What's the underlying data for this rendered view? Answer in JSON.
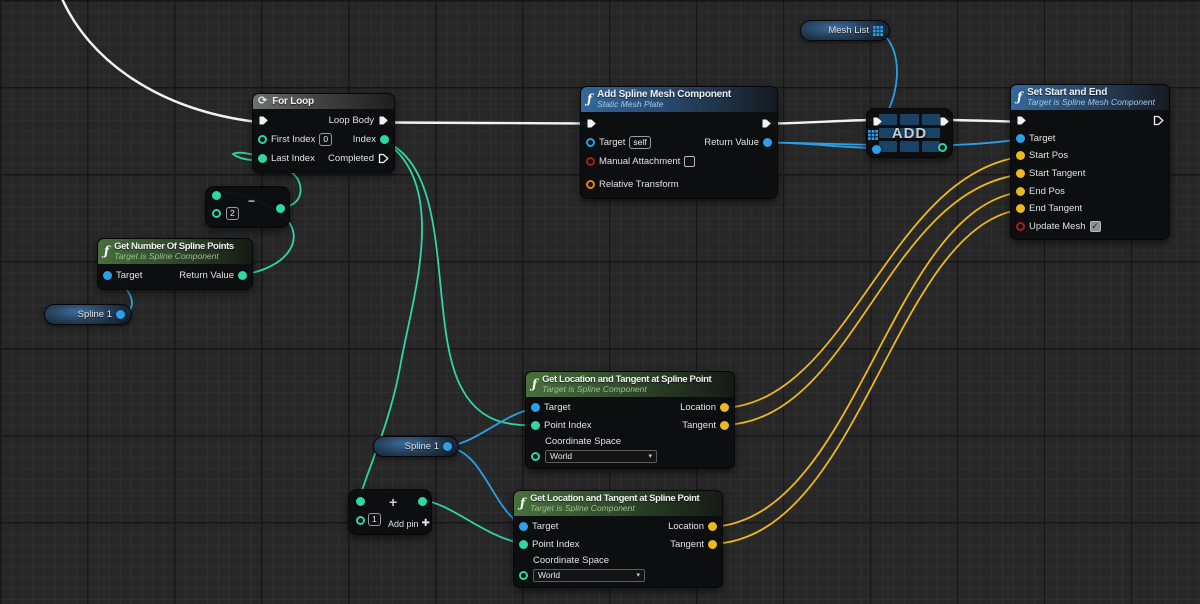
{
  "colors": {
    "exec_wire": "#F2F2F2",
    "int_pin": "#2FD6A6",
    "object_pin": "#2D9FE6",
    "vector_pin": "#EDB71E",
    "bool_pin": "#A61E1E",
    "transform_pin": "#E8820D"
  },
  "icons": {
    "function": "ƒ",
    "loop": "⟳",
    "dropdown_caret": "▾",
    "check": "✓",
    "add_pin_plus": "✚"
  },
  "nodes": {
    "for_loop": {
      "title": "For Loop",
      "loop_body_label": "Loop Body",
      "first_index_label": "First Index",
      "first_index_value": "0",
      "index_label": "Index",
      "last_index_label": "Last Index",
      "completed_label": "Completed"
    },
    "add_spline_mesh": {
      "title": "Add Spline Mesh Component",
      "subtitle": "Static Mesh Plate",
      "target_label": "Target",
      "target_value": "self",
      "manual_attachment_label": "Manual Attachment",
      "relative_transform_label": "Relative Transform",
      "return_value_label": "Return Value"
    },
    "set_start_and_end": {
      "title": "Set Start and End",
      "subtitle": "Target is Spline Mesh Component",
      "target_label": "Target",
      "start_pos_label": "Start Pos",
      "start_tangent_label": "Start Tangent",
      "end_pos_label": "End Pos",
      "end_tangent_label": "End Tangent",
      "update_mesh_label": "Update Mesh"
    },
    "mesh_list": {
      "label": "Mesh List"
    },
    "array_add": {
      "label": "ADD"
    },
    "get_number_of_spline_points": {
      "title": "Get Number Of Spline Points",
      "subtitle": "Target is Spline Component",
      "target_label": "Target",
      "return_value_label": "Return Value"
    },
    "spline_var_left": {
      "label": "Spline 1"
    },
    "subtract_int": {
      "operator": "−",
      "b_value": "2"
    },
    "get_location_1": {
      "title": "Get Location and Tangent at Spline Point",
      "subtitle": "Target is Spline Component",
      "target_label": "Target",
      "point_index_label": "Point Index",
      "coordinate_space_label": "Coordinate Space",
      "coordinate_space_value": "World",
      "location_label": "Location",
      "tangent_label": "Tangent"
    },
    "spline_var_mid": {
      "label": "Spline 1"
    },
    "add_int": {
      "operator": "+",
      "b_value": "1",
      "add_pin_label": "Add pin"
    },
    "get_location_2": {
      "title": "Get Location and Tangent at Spline Point",
      "subtitle": "Target is Spline Component",
      "target_label": "Target",
      "point_index_label": "Point Index",
      "coordinate_space_label": "Coordinate Space",
      "coordinate_space_value": "World",
      "location_label": "Location",
      "tangent_label": "Tangent"
    }
  }
}
